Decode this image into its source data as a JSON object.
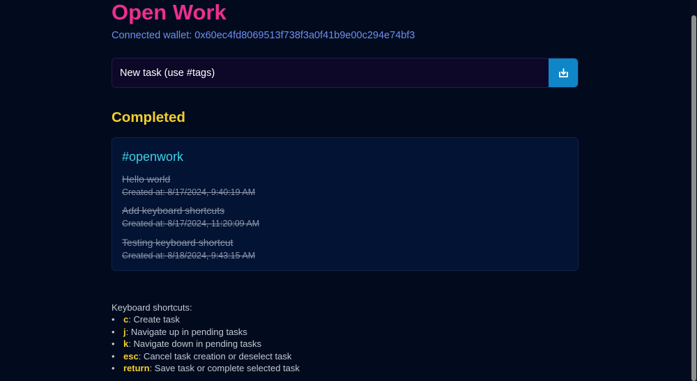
{
  "app": {
    "title": "Open Work",
    "wallet": "Connected wallet: 0x60ec4fd8069513f738f3a0f41b9e00c294e74bf3"
  },
  "new_task": {
    "placeholder": "New task (use #tags)",
    "value": "",
    "save_icon": "download-icon"
  },
  "completed": {
    "title": "Completed",
    "groups": [
      {
        "tag": "#openwork",
        "tasks": [
          {
            "text": "Hello world",
            "created": "Created at: 8/17/2024, 9:40:19 AM"
          },
          {
            "text": "Add keyboard shortcuts",
            "created": "Created at: 8/17/2024, 11:20:09 AM"
          },
          {
            "text": "Testing keyboard shortcut",
            "created": "Created at: 8/18/2024, 9:43:15 AM"
          }
        ]
      }
    ]
  },
  "shortcuts": {
    "title": "Keyboard shortcuts:",
    "bullet": "•",
    "items": [
      {
        "key": "c",
        "desc": ": Create task"
      },
      {
        "key": "j",
        "desc": ": Navigate up in pending tasks"
      },
      {
        "key": "k",
        "desc": ": Navigate down in pending tasks"
      },
      {
        "key": "esc",
        "desc": ": Cancel task creation or deselect task"
      },
      {
        "key": "return",
        "desc": ": Save task or complete selected task"
      }
    ]
  },
  "colors": {
    "background": "#020b1e",
    "title": "#ec2f8f",
    "wallet": "#6f8ff0",
    "section": "#f5cf2b",
    "tag": "#3fd0e6",
    "button": "#0f86c8"
  }
}
